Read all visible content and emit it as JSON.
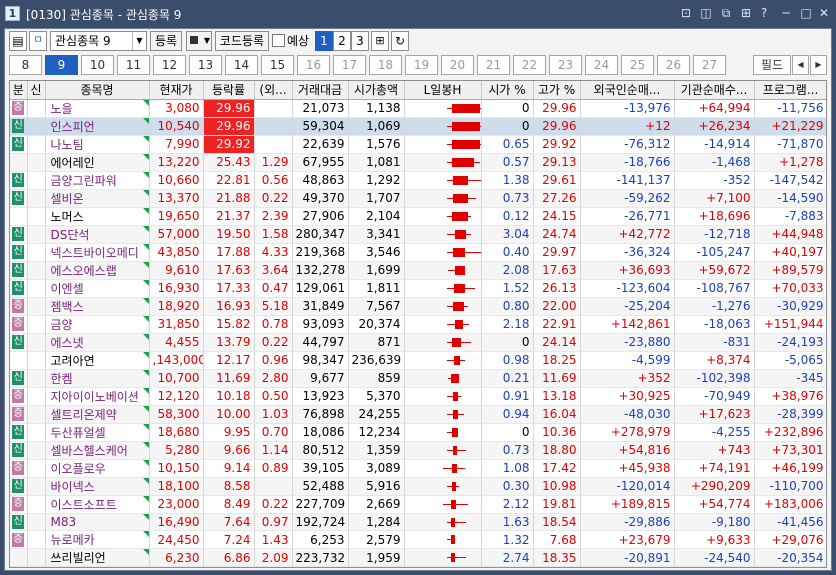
{
  "window": {
    "icon": "1",
    "title": "[0130] 관심종목 - 관심종목 9",
    "buttons": [
      "maximize-restore-icon",
      "tile-icon",
      "copy-icon",
      "grid-icon",
      "help-icon",
      "minimize-icon",
      "maximize-icon",
      "close-icon"
    ],
    "glyphs": [
      "⊡",
      "◫",
      "⧉",
      "⊞",
      "?",
      "─",
      "□",
      "✕"
    ]
  },
  "toolbar": {
    "group": "관심종목 9",
    "register": "등록",
    "code_register": "코드등록",
    "forecast": "예상",
    "views": [
      "1",
      "2",
      "3"
    ],
    "selected_view": "1"
  },
  "pages": {
    "items": [
      "8",
      "9",
      "10",
      "11",
      "12",
      "13",
      "14",
      "15",
      "16",
      "17",
      "18",
      "19",
      "20",
      "21",
      "22",
      "23",
      "24",
      "25",
      "26",
      "27"
    ],
    "selected": "9",
    "active_through": "15",
    "filter": "필드"
  },
  "grid": {
    "headers": [
      "분",
      "신",
      "종목명",
      "현재가",
      "등락률",
      "(외...",
      "거래대금",
      "시가총액",
      "L일봉H",
      "시가 %",
      "고가 %",
      "외국인순매...",
      "기관순매수...",
      "프로그램..."
    ],
    "rows": [
      {
        "b": "증",
        "n": "노을",
        "p": "3,080",
        "r": "29.96",
        "o": "",
        "v": "21,073",
        "m": "1,138",
        "s": "0",
        "h": "29.96",
        "f": "-13,976",
        "i": "+64,994",
        "g": "-11,756",
        "bar": [
          0.55,
          1.0,
          0.62,
          0.98
        ]
      },
      {
        "b": "신",
        "n": "인스피언",
        "p": "10,540",
        "r": "29.96",
        "o": "",
        "v": "59,304",
        "m": "1,069",
        "s": "0",
        "h": "29.96",
        "f": "+12",
        "i": "+26,234",
        "g": "+21,229",
        "bar": [
          0.55,
          1.0,
          0.62,
          0.98
        ]
      },
      {
        "b": "신",
        "n": "나노팀",
        "p": "7,990",
        "r": "29.92",
        "o": "",
        "v": "22,639",
        "m": "1,576",
        "s": "0.65",
        "h": "29.92",
        "f": "-76,312",
        "i": "-14,914",
        "g": "-71,870",
        "bar": [
          0.55,
          1.0,
          0.62,
          0.98
        ]
      },
      {
        "b": "",
        "n": "에어레인",
        "p": "13,220",
        "r": "25.43",
        "o": "1.29",
        "v": "67,955",
        "m": "1,081",
        "s": "0.57",
        "h": "29.13",
        "f": "-18,766",
        "i": "-1,468",
        "g": "+1,278",
        "bar": [
          0.55,
          0.98,
          0.62,
          0.9
        ]
      },
      {
        "b": "신",
        "n": "금양그린파워",
        "p": "10,660",
        "r": "22.81",
        "o": "0.56",
        "v": "48,863",
        "m": "1,292",
        "s": "1.38",
        "h": "29.61",
        "f": "-141,137",
        "i": "-352",
        "g": "-147,542",
        "bar": [
          0.55,
          0.99,
          0.63,
          0.83
        ]
      },
      {
        "b": "신",
        "n": "셀비온",
        "p": "13,370",
        "r": "21.88",
        "o": "0.22",
        "v": "49,370",
        "m": "1,707",
        "s": "0.73",
        "h": "27.26",
        "f": "-59,262",
        "i": "+7,100",
        "g": "-14,590",
        "bar": [
          0.55,
          0.93,
          0.63,
          0.82
        ]
      },
      {
        "b": "",
        "n": "노머스",
        "p": "19,650",
        "r": "21.37",
        "o": "2.39",
        "v": "27,906",
        "m": "2,104",
        "s": "0.12",
        "h": "24.15",
        "f": "-26,771",
        "i": "+18,696",
        "g": "-7,883",
        "bar": [
          0.55,
          0.86,
          0.62,
          0.83
        ]
      },
      {
        "b": "신",
        "n": "DS단석",
        "p": "57,000",
        "r": "19.50",
        "o": "1.58",
        "v": "280,347",
        "m": "3,341",
        "s": "3.04",
        "h": "24.74",
        "f": "+42,772",
        "i": "-12,718",
        "g": "+44,948",
        "bar": [
          0.55,
          0.87,
          0.66,
          0.8
        ]
      },
      {
        "b": "신",
        "n": "넥스트바이오메디",
        "p": "43,850",
        "r": "17.88",
        "o": "4.33",
        "v": "219,368",
        "m": "3,546",
        "s": "0.40",
        "h": "29.97",
        "f": "-36,324",
        "i": "-105,247",
        "g": "+40,197",
        "bar": [
          0.55,
          1.0,
          0.63,
          0.78
        ]
      },
      {
        "b": "신",
        "n": "에스오에스랩",
        "p": "9,610",
        "r": "17.63",
        "o": "3.64",
        "v": "132,278",
        "m": "1,699",
        "s": "2.08",
        "h": "17.63",
        "f": "+36,693",
        "i": "+59,672",
        "g": "+89,579",
        "bar": [
          0.56,
          0.79,
          0.65,
          0.79
        ]
      },
      {
        "b": "신",
        "n": "이엔셀",
        "p": "16,930",
        "r": "17.33",
        "o": "0.47",
        "v": "129,061",
        "m": "1,811",
        "s": "1.52",
        "h": "26.13",
        "f": "-123,604",
        "i": "-108,767",
        "g": "+70,033",
        "bar": [
          0.55,
          0.91,
          0.64,
          0.78
        ]
      },
      {
        "b": "증",
        "n": "젬백스",
        "p": "18,920",
        "r": "16.93",
        "o": "5.18",
        "v": "31,849",
        "m": "7,567",
        "s": "0.80",
        "h": "22.00",
        "f": "-25,204",
        "i": "-1,276",
        "g": "-30,929",
        "bar": [
          0.55,
          0.83,
          0.63,
          0.77
        ]
      },
      {
        "b": "증",
        "n": "금양",
        "p": "31,850",
        "r": "15.82",
        "o": "0.78",
        "v": "93,093",
        "m": "20,374",
        "s": "2.18",
        "h": "22.91",
        "f": "+142,861",
        "i": "-18,063",
        "g": "+151,944",
        "bar": [
          0.55,
          0.84,
          0.65,
          0.76
        ]
      },
      {
        "b": "신",
        "n": "에스넷",
        "p": "4,455",
        "r": "13.79",
        "o": "0.22",
        "v": "44,797",
        "m": "871",
        "s": "0",
        "h": "24.14",
        "f": "-23,880",
        "i": "-831",
        "g": "-24,193",
        "bar": [
          0.55,
          0.86,
          0.62,
          0.73
        ]
      },
      {
        "b": "",
        "n": "고려아연",
        "p": ",143,000",
        "r": "12.17",
        "o": "0.96",
        "v": "98,347",
        "m": "236,639",
        "s": "0.98",
        "h": "18.25",
        "f": "-4,599",
        "i": "+8,374",
        "g": "-5,065",
        "bar": [
          0.55,
          0.79,
          0.64,
          0.72
        ]
      },
      {
        "b": "신",
        "n": "한켐",
        "p": "10,700",
        "r": "11.69",
        "o": "2.80",
        "v": "9,677",
        "m": "859",
        "s": "0.21",
        "h": "11.69",
        "f": "+352",
        "i": "-102,398",
        "g": "-345",
        "bar": [
          0.56,
          0.71,
          0.6,
          0.71
        ]
      },
      {
        "b": "증",
        "n": "지아이이노베이션",
        "p": "12,120",
        "r": "10.18",
        "o": "0.50",
        "v": "13,923",
        "m": "5,370",
        "s": "0.91",
        "h": "13.18",
        "f": "+30,925",
        "i": "-70,949",
        "g": "+38,976",
        "bar": [
          0.55,
          0.74,
          0.63,
          0.69
        ]
      },
      {
        "b": "증",
        "n": "셀트리온제약",
        "p": "58,300",
        "r": "10.00",
        "o": "1.03",
        "v": "76,898",
        "m": "24,255",
        "s": "0.94",
        "h": "16.04",
        "f": "-48,030",
        "i": "+17,623",
        "g": "-28,399",
        "bar": [
          0.55,
          0.77,
          0.63,
          0.69
        ]
      },
      {
        "b": "신",
        "n": "두산퓨얼셀",
        "p": "18,680",
        "r": "9.95",
        "o": "0.70",
        "v": "18,086",
        "m": "12,234",
        "s": "0",
        "h": "10.36",
        "f": "+278,979",
        "i": "-4,255",
        "g": "+232,896",
        "bar": [
          0.55,
          0.7,
          0.62,
          0.69
        ]
      },
      {
        "b": "신",
        "n": "셀바스헬스케어",
        "p": "5,280",
        "r": "9.66",
        "o": "1.14",
        "v": "80,512",
        "m": "1,359",
        "s": "0.73",
        "h": "18.80",
        "f": "+54,816",
        "i": "+743",
        "g": "+73,301",
        "bar": [
          0.55,
          0.8,
          0.63,
          0.68
        ]
      },
      {
        "b": "증",
        "n": "이오플로우",
        "p": "10,150",
        "r": "9.14",
        "o": "0.89",
        "v": "39,105",
        "m": "3,089",
        "s": "1.08",
        "h": "17.42",
        "f": "+45,938",
        "i": "+74,191",
        "g": "+46,199",
        "bar": [
          0.5,
          0.79,
          0.62,
          0.68
        ]
      },
      {
        "b": "신",
        "n": "바이넥스",
        "p": "18,100",
        "r": "8.58",
        "o": "",
        "v": "52,488",
        "m": "5,916",
        "s": "0.30",
        "h": "10.98",
        "f": "-120,014",
        "i": "+290,209",
        "g": "-110,700",
        "bar": [
          0.55,
          0.71,
          0.62,
          0.67
        ]
      },
      {
        "b": "증",
        "n": "이스트소프트",
        "p": "23,000",
        "r": "8.49",
        "o": "0.22",
        "v": "227,709",
        "m": "2,669",
        "s": "2.12",
        "h": "19.81",
        "f": "+189,815",
        "i": "+54,774",
        "g": "+183,006",
        "bar": [
          0.5,
          0.82,
          0.6,
          0.67
        ]
      },
      {
        "b": "신",
        "n": "M83",
        "p": "16,490",
        "r": "7.64",
        "o": "0.97",
        "v": "192,724",
        "m": "1,284",
        "s": "1.63",
        "h": "18.54",
        "f": "-29,886",
        "i": "-9,180",
        "g": "-41,456",
        "bar": [
          0.55,
          0.8,
          0.61,
          0.66
        ]
      },
      {
        "b": "증",
        "n": "뉴로메카",
        "p": "24,450",
        "r": "7.24",
        "o": "1.43",
        "v": "6,253",
        "m": "2,579",
        "s": "1.32",
        "h": "7.68",
        "f": "+23,679",
        "i": "+9,633",
        "g": "+29,076",
        "bar": [
          0.55,
          0.66,
          0.61,
          0.66
        ]
      },
      {
        "b": "",
        "n": "쓰리빌리언",
        "p": "6,230",
        "r": "6.86",
        "o": "2.09",
        "v": "223,732",
        "m": "1,959",
        "s": "2.74",
        "h": "18.35",
        "f": "-20,891",
        "i": "-24,540",
        "g": "-20,354",
        "bar": [
          0.55,
          0.8,
          0.61,
          0.65
        ]
      }
    ]
  }
}
